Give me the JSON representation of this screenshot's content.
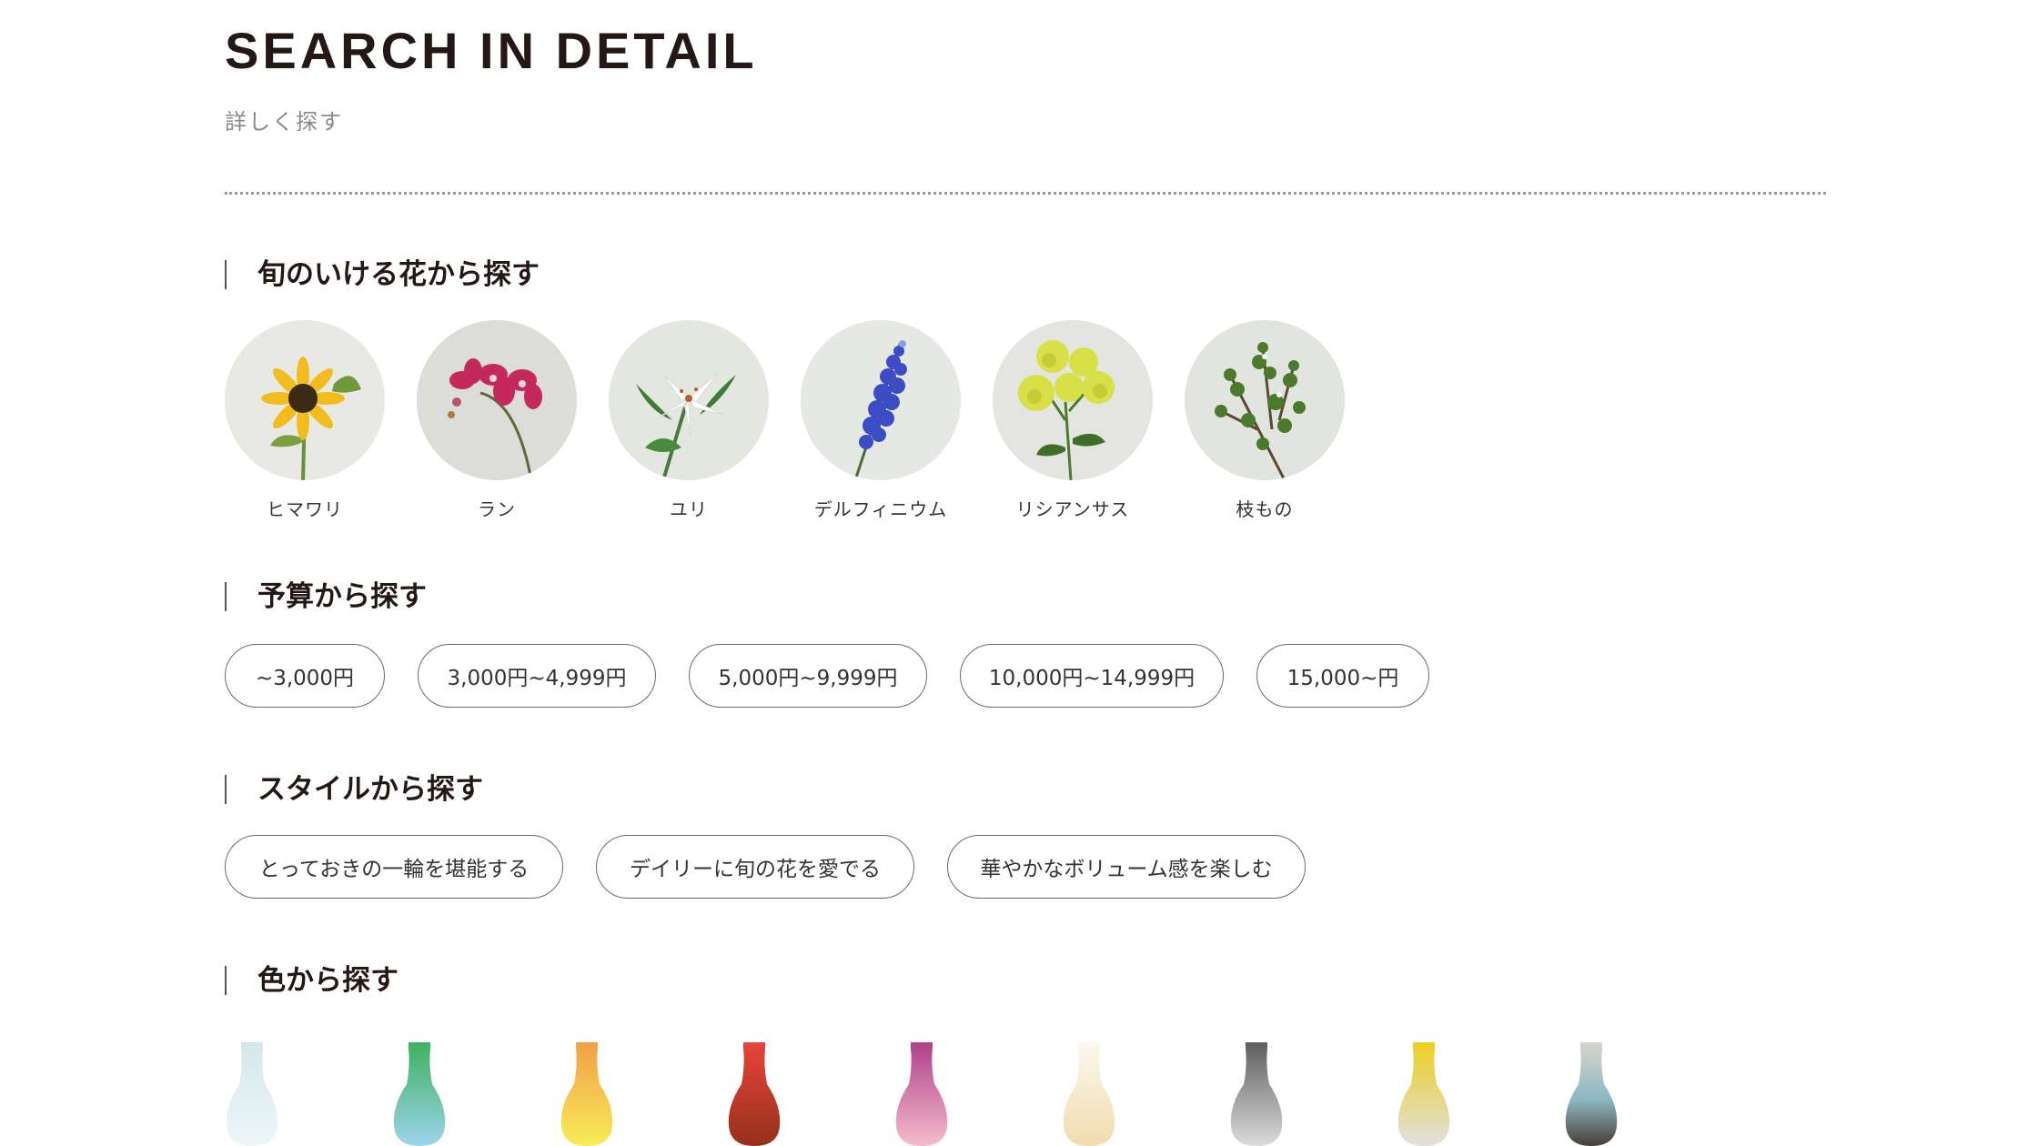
{
  "header": {
    "title": "SEARCH IN DETAIL",
    "subtitle": "詳しく探す"
  },
  "seasonal": {
    "heading": "旬のいける花から探す",
    "items": [
      {
        "label": "ヒマワリ",
        "icon": "sunflower-icon"
      },
      {
        "label": "ラン",
        "icon": "orchid-icon"
      },
      {
        "label": "ユリ",
        "icon": "lily-icon"
      },
      {
        "label": "デルフィニウム",
        "icon": "delphinium-icon"
      },
      {
        "label": "リシアンサス",
        "icon": "lisianthus-icon"
      },
      {
        "label": "枝もの",
        "icon": "branch-icon"
      }
    ]
  },
  "budget": {
    "heading": "予算から探す",
    "items": [
      {
        "label": "~3,000円"
      },
      {
        "label": "3,000円~4,999円"
      },
      {
        "label": "5,000円~9,999円"
      },
      {
        "label": "10,000円~14,999円"
      },
      {
        "label": "15,000~円"
      }
    ]
  },
  "style": {
    "heading": "スタイルから探す",
    "items": [
      {
        "label": "とっておきの一輪を堪能する"
      },
      {
        "label": "デイリーに旬の花を愛でる"
      },
      {
        "label": "華やかなボリューム感を楽しむ"
      }
    ]
  },
  "color": {
    "heading": "色から探す",
    "items": [
      {
        "top": "#d3e8ec",
        "bottom": "#eef6f8"
      },
      {
        "top": "#3fb060",
        "bottom": "#9dd4ec"
      },
      {
        "top": "#f0a048",
        "bottom": "#f8ec58"
      },
      {
        "top": "#e8443a",
        "bottom": "#96301c"
      },
      {
        "top": "#b0408c",
        "bottom": "#f6bccc"
      },
      {
        "top": "#fcf8ee",
        "bottom": "#f0dcb0"
      },
      {
        "top": "#5e5e5e",
        "bottom": "#dcdcdc"
      },
      {
        "top": "#ecd020",
        "bottom": "#e0e0e0"
      },
      {
        "top": "#d8d4cc",
        "mid": "#8cb8c4",
        "bottom": "#4a3c36"
      }
    ]
  }
}
